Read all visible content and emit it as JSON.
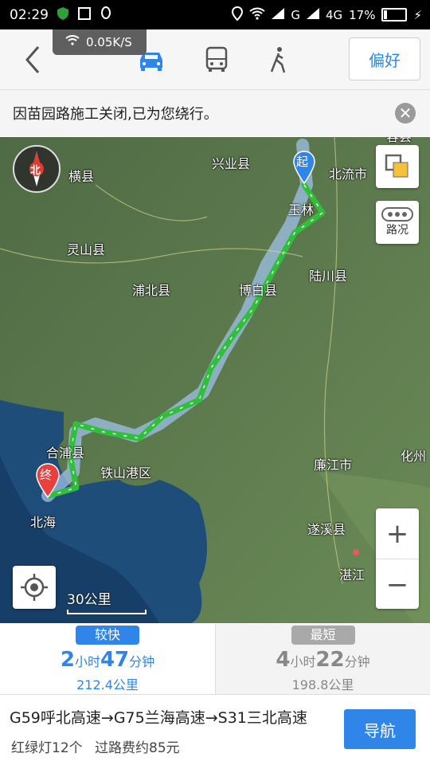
{
  "status": {
    "time": "02:29",
    "signal_g": "G",
    "signal_4g": "4G",
    "battery": "17%",
    "battery_level": 0.17
  },
  "speed_label": "0.05K/S",
  "top": {
    "pref_label": "偏好"
  },
  "notice": {
    "text": "因苗园路施工关闭,已为您绕行。"
  },
  "map": {
    "labels": {
      "hengxian": "横县",
      "xingye": "兴业县",
      "beiliu": "北流市",
      "yulin": "玉林",
      "rongxian": "容县",
      "lingshan": "灵山县",
      "luchuan": "陆川县",
      "pubei": "浦北县",
      "bobai": "博白县",
      "hepu": "合浦县",
      "tieshangang": "铁山港区",
      "lianjiang": "廉江市",
      "huazhou": "化州",
      "beihai": "北海",
      "suixi": "遂溪县",
      "zhanjiang": "湛江"
    },
    "start_marker": "起",
    "end_marker": "终",
    "compass_label": "北",
    "traffic_label": "路况",
    "scale": "30公里"
  },
  "routes": [
    {
      "tag": "较快",
      "hours": "2",
      "h_unit": "小时",
      "minutes": "47",
      "m_unit": "分钟",
      "distance": "212.4公里",
      "color": "#2f86e8"
    },
    {
      "tag": "最短",
      "hours": "4",
      "h_unit": "小时",
      "minutes": "22",
      "m_unit": "分钟",
      "distance": "198.8公里",
      "color": "#a9a9a9"
    }
  ],
  "summary": {
    "road": "G59呼北高速→G75兰海高速→S31三北高速",
    "lights": "红绿灯12个",
    "toll": "过路费约85元",
    "nav_label": "导航"
  }
}
